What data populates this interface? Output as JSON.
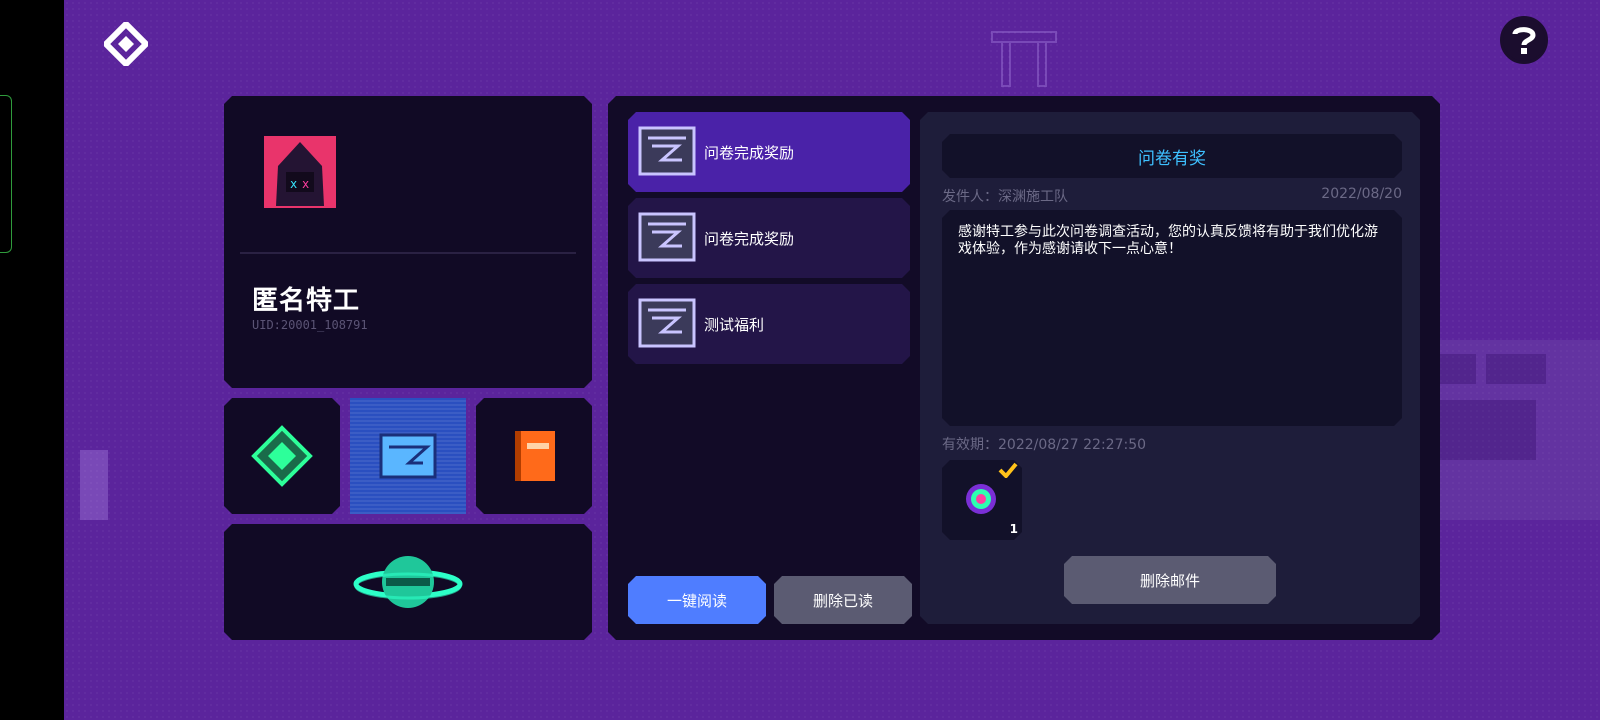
{
  "colors": {
    "background": "#5b249c",
    "panel": "#120b27",
    "active_item": "#4a22a8",
    "accent_blue": "#4f7dff",
    "title_cyan": "#3ec0ff",
    "muted_button": "#5b5b72"
  },
  "profile": {
    "name": "匿名特工",
    "uid": "UID:20001_108791"
  },
  "mail_list": [
    {
      "title": "问卷完成奖励",
      "icon": "envelope-icon",
      "active": true
    },
    {
      "title": "问卷完成奖励",
      "icon": "envelope-icon",
      "active": false
    },
    {
      "title": "测试福利",
      "icon": "envelope-icon",
      "active": false
    }
  ],
  "buttons": {
    "read_all": "一键阅读",
    "delete_read": "删除已读",
    "delete_mail": "删除邮件"
  },
  "detail": {
    "title": "问卷有奖",
    "sender": "发件人：深渊施工队",
    "date": "2022/08/20",
    "body": "感谢特工参与此次问卷调查活动，您的认真反馈将有助于我们优化游戏体验，作为感谢请收下一点心意！",
    "expiry": "有效期：2022/08/27 22:27:50",
    "reward_quantity": "1"
  }
}
